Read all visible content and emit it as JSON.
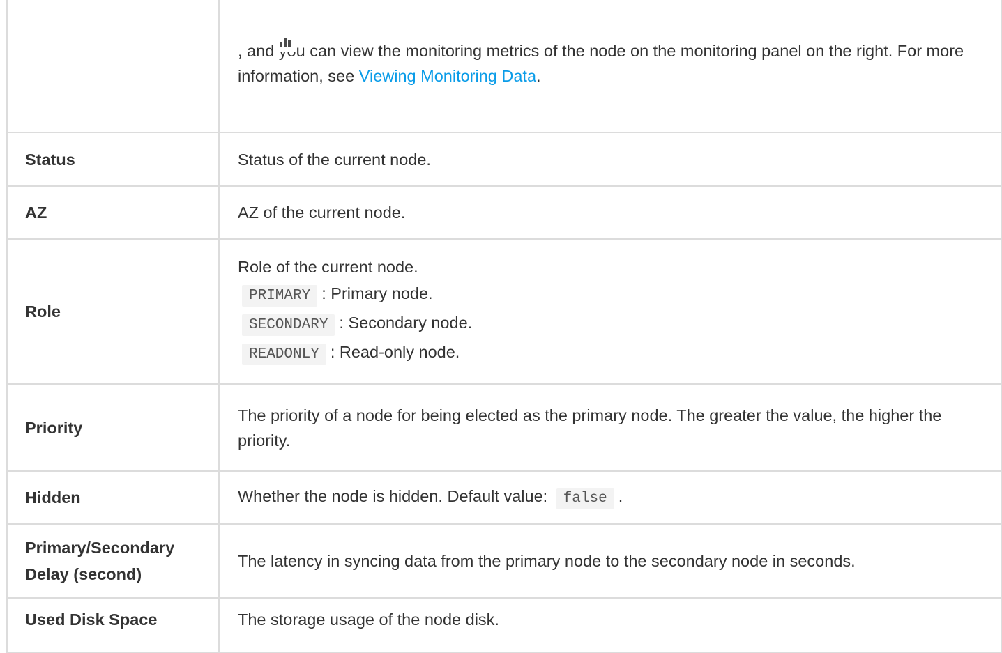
{
  "rows": [
    {
      "name": "",
      "desc_parts": {
        "text1": ", and you can view the monitoring metrics of the node on the monitoring panel on the right. For more information, see ",
        "link": "Viewing Monitoring Data",
        "text2": "."
      },
      "icon": "monitoring-bar-chart-icon"
    },
    {
      "name": "Status",
      "desc": "Status of the current node."
    },
    {
      "name": "AZ",
      "desc": "AZ of the current node."
    },
    {
      "name": "Role",
      "desc": "Role of the current node.",
      "items": [
        {
          "code": "PRIMARY",
          "text": ": Primary node."
        },
        {
          "code": "SECONDARY",
          "text": ": Secondary node."
        },
        {
          "code": "READONLY",
          "text": ": Read-only node."
        }
      ]
    },
    {
      "name": "Priority",
      "desc": "The priority of a node for being elected as the primary node. The greater the value, the higher the priority."
    },
    {
      "name": "Hidden",
      "desc": "Whether the node is hidden. Default value:",
      "code": "false",
      "suffix": "."
    },
    {
      "name": "Primary/Secondary Delay (second)",
      "desc": "The latency in syncing data from the primary node to the secondary node in seconds."
    },
    {
      "name": "Used Disk Space",
      "desc": "The storage usage of the node disk."
    }
  ],
  "colors": {
    "link": "#0a9ce8",
    "border": "#dcdcdc",
    "code_bg": "#f3f3f3",
    "text": "#333333"
  }
}
